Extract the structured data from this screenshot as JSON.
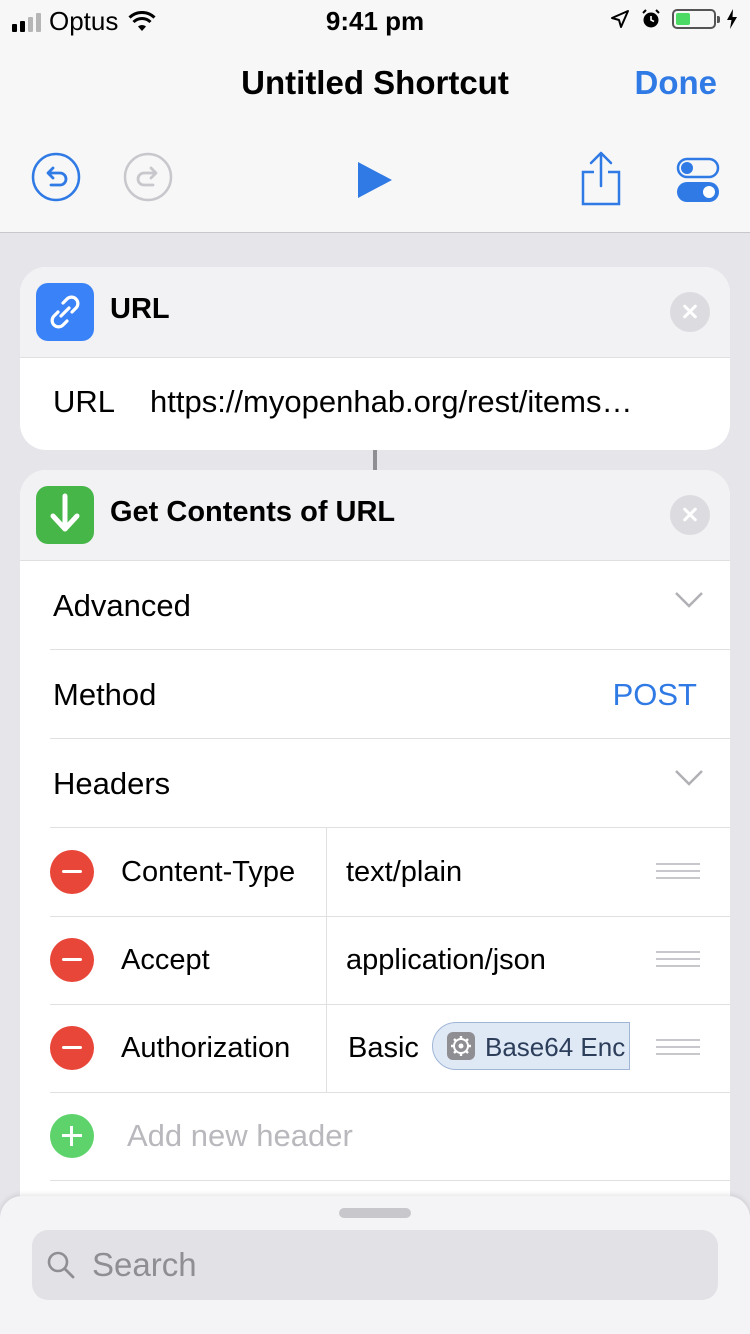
{
  "status_bar": {
    "carrier": "Optus",
    "time": "9:41 pm",
    "battery_level": 0.4,
    "battery_color": "#4cd964"
  },
  "nav": {
    "title": "Untitled Shortcut",
    "done_label": "Done",
    "toolbar_icons": [
      "undo-icon",
      "redo-icon",
      "play-icon",
      "share-icon",
      "settings-toggle-icon"
    ]
  },
  "url_action": {
    "title": "URL",
    "field_label": "URL",
    "field_value": "https://myopenhab.org/rest/items…",
    "icon": "link-icon",
    "icon_color": "#3a82f7"
  },
  "get_contents_action": {
    "title": "Get Contents of URL",
    "icon": "download-arrow-icon",
    "icon_color": "#46b648",
    "advanced_label": "Advanced",
    "method_label": "Method",
    "method_value": "POST",
    "headers_label": "Headers",
    "headers": [
      {
        "key": "Content-Type",
        "value": "text/plain"
      },
      {
        "key": "Accept",
        "value": "application/json"
      },
      {
        "key": "Authorization",
        "value": "Basic",
        "token": "Base64 Enc"
      }
    ],
    "add_header_placeholder": "Add new header"
  },
  "bottom_sheet": {
    "search_placeholder": "Search"
  },
  "colors": {
    "accent": "#2f7ae5",
    "delete": "#e9463a",
    "add": "#5ed36b"
  }
}
